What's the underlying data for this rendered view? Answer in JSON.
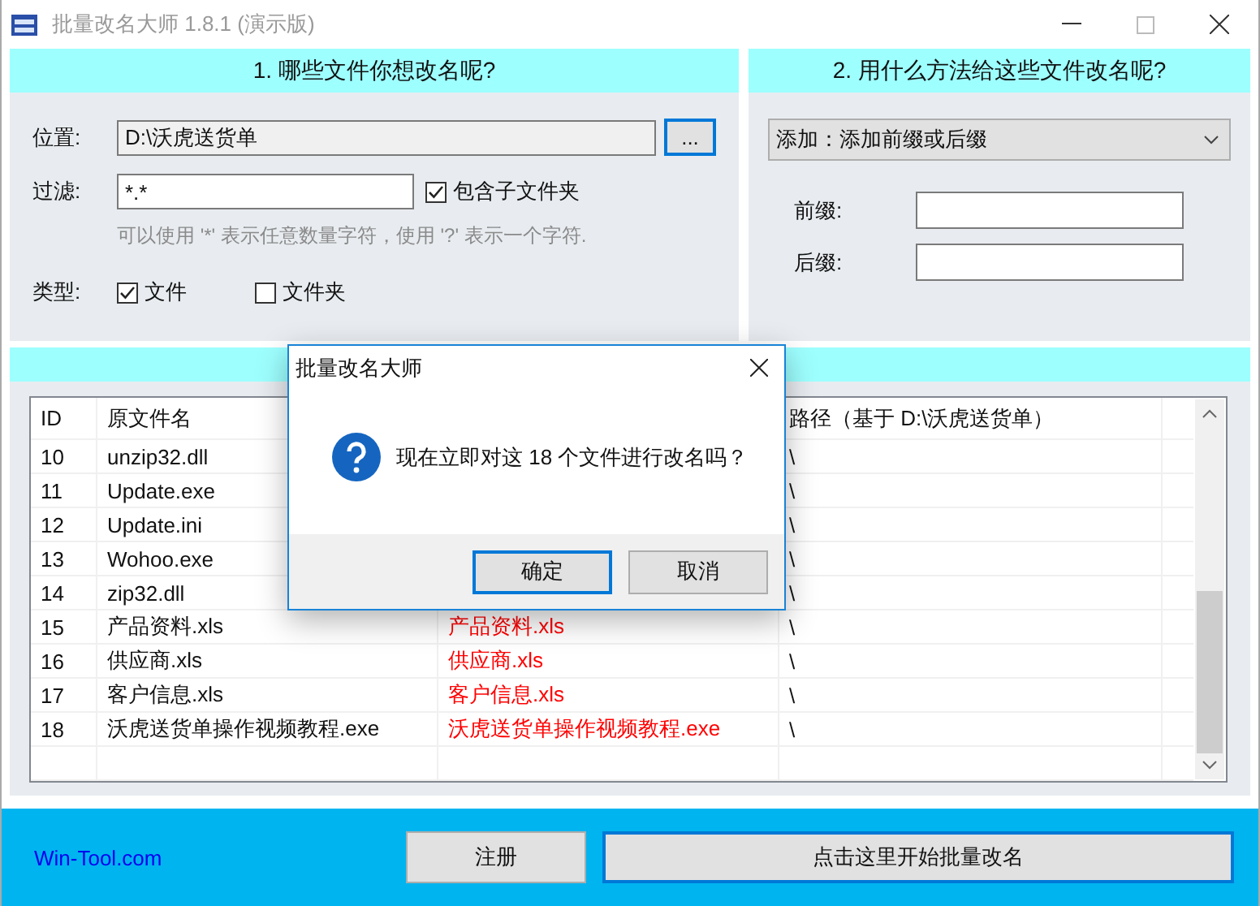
{
  "window": {
    "title": "批量改名大师 1.8.1 (演示版)"
  },
  "panel_source": {
    "header": "1. 哪些文件你想改名呢?",
    "location_label": "位置:",
    "location_value": "D:\\沃虎送货单",
    "browse_button": "...",
    "filter_label": "过滤:",
    "filter_value": "*.*",
    "include_subfolders": {
      "label": "包含子文件夹",
      "checked": true
    },
    "hint": "可以使用 '*' 表示任意数量字符，使用 '?' 表示一个字符.",
    "type_label": "类型:",
    "types": [
      {
        "label": "文件",
        "checked": true
      },
      {
        "label": "文件夹",
        "checked": false
      }
    ]
  },
  "panel_method": {
    "header": "2. 用什么方法给这些文件改名呢?",
    "method": "添加：添加前缀或后缀",
    "prefix_label": "前缀:",
    "suffix_label": "后缀:"
  },
  "table": {
    "id_header": "ID",
    "name_header": "原文件名",
    "path_header": "路径（基于 D:\\沃虎送货单）",
    "rows": [
      {
        "id": "10",
        "name": "unzip32.dll",
        "path": "\\"
      },
      {
        "id": "11",
        "name": "Update.exe",
        "path": "\\"
      },
      {
        "id": "12",
        "name": "Update.ini",
        "path": "\\"
      },
      {
        "id": "13",
        "name": "Wohoo.exe",
        "path": "\\"
      },
      {
        "id": "14",
        "name": "zip32.dll",
        "path": "\\"
      },
      {
        "id": "15",
        "name": "产品资料.xls",
        "new_name": "产品资料.xls",
        "path": "\\"
      },
      {
        "id": "16",
        "name": "供应商.xls",
        "new_name": "供应商.xls",
        "path": "\\"
      },
      {
        "id": "17",
        "name": "客户信息.xls",
        "new_name": "客户信息.xls",
        "path": "\\"
      },
      {
        "id": "18",
        "name": "沃虎送货单操作视频教程.exe",
        "new_name": "沃虎送货单操作视频教程.exe",
        "path": "\\"
      }
    ]
  },
  "dialog": {
    "title": "批量改名大师",
    "message": "现在立即对这 18 个文件进行改名吗？",
    "buttons": [
      {
        "label": "确定",
        "default": true
      },
      {
        "label": "取消",
        "default": false
      }
    ]
  },
  "footer": {
    "link": "Win-Tool.com",
    "buttons": [
      {
        "label": "注册",
        "default": false
      },
      {
        "label": "点击这里开始批量改名",
        "default": true
      }
    ]
  }
}
